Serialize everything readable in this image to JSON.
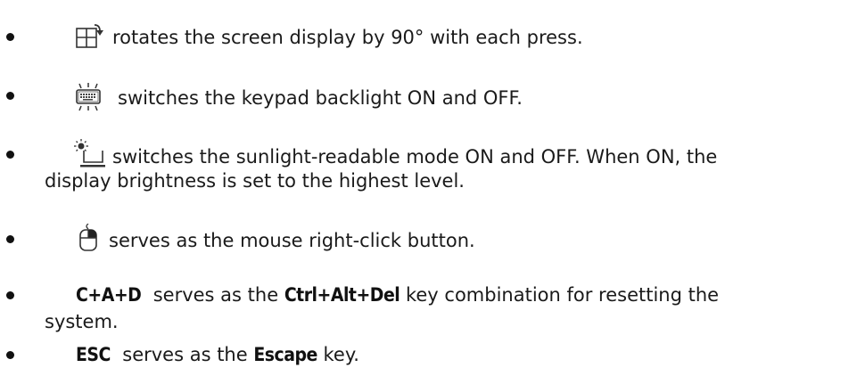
{
  "items": [
    {
      "icon": "rotate-screen-icon",
      "text": "rotates the screen display by 90° with each press."
    },
    {
      "icon": "keypad-backlight-icon",
      "text": "switches the keypad backlight ON and OFF."
    },
    {
      "icon": "sunlight-readable-icon",
      "text_line1": "switches the sunlight-readable mode ON and OFF. When ON, the",
      "text_line2": "display brightness is set to the highest level."
    },
    {
      "icon": "mouse-right-click-icon",
      "text": "serves as the mouse right-click button."
    },
    {
      "key": "C+A+D",
      "text_mid": "serves as the",
      "key2": "Ctrl+Alt+Del",
      "text_line1_end": "key combination for resetting the",
      "text_line2": "system."
    },
    {
      "key": "ESC",
      "text_mid": "serves as the",
      "key2": "Escape",
      "text_end": "key."
    }
  ]
}
